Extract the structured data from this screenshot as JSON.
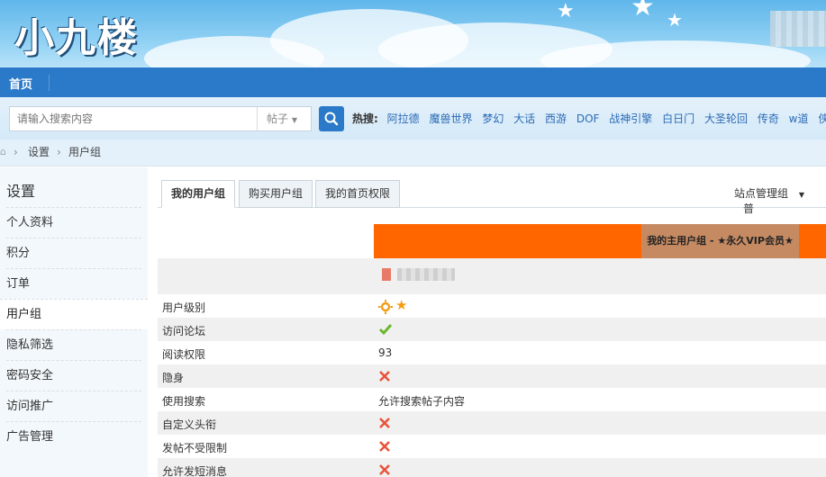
{
  "site": {
    "logo": "小九楼"
  },
  "nav": {
    "home": "首页"
  },
  "search": {
    "placeholder": "请输入搜索内容",
    "type": "帖子",
    "hot_label": "热搜:",
    "hot_links": [
      "阿拉德",
      "魔兽世界",
      "梦幻",
      "大话",
      "西游",
      "DOF",
      "战神引擎",
      "白日门",
      "大圣轮回",
      "传奇",
      "w道",
      "侠盗猎车"
    ]
  },
  "breadcrumb": {
    "settings": "设置",
    "current": "用户组"
  },
  "sidebar": {
    "title": "设置",
    "items": [
      "个人资料",
      "积分",
      "订单",
      "用户组",
      "隐私筛选",
      "密码安全",
      "访问推广",
      "广告管理"
    ]
  },
  "tabs": [
    "我的用户组",
    "购买用户组",
    "我的首页权限"
  ],
  "site_admin": "站点管理组",
  "site_admin_more": "普",
  "main_group": "我的主用户组 - ★永久VIP会员★",
  "rows": [
    {
      "label": "用户级别",
      "value": "",
      "icon": "level-icons"
    },
    {
      "label": "访问论坛",
      "value": "",
      "icon": "check-icon"
    },
    {
      "label": "阅读权限",
      "value": "93",
      "icon": ""
    },
    {
      "label": "隐身",
      "value": "",
      "icon": "cross-icon"
    },
    {
      "label": "使用搜索",
      "value": "允许搜索帖子内容",
      "icon": ""
    },
    {
      "label": "自定义头衔",
      "value": "",
      "icon": "cross-icon"
    },
    {
      "label": "发帖不受限制",
      "value": "",
      "icon": "cross-icon"
    },
    {
      "label": "允许发短消息",
      "value": "",
      "icon": "cross-icon"
    }
  ],
  "colors": {
    "brand": "#2b79c9",
    "orange": "#ff6600",
    "check": "#6ab82b",
    "cross": "#e8543a",
    "star": "#f39c12"
  }
}
